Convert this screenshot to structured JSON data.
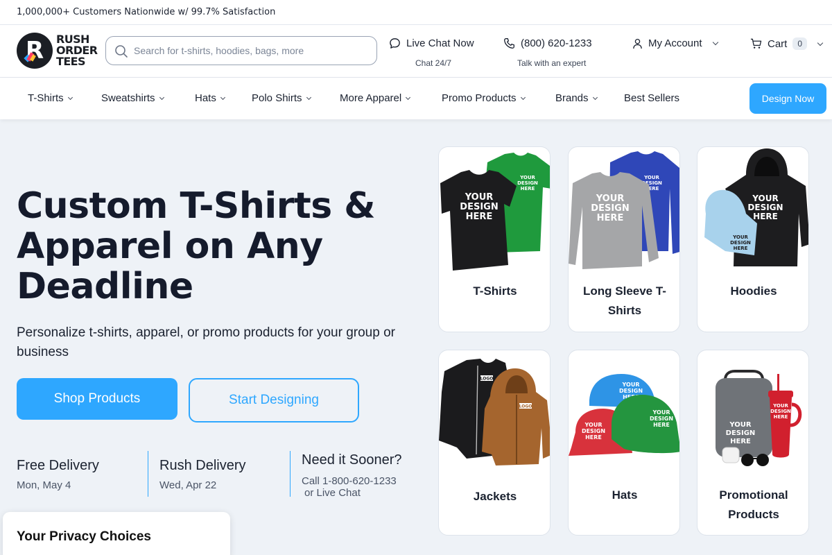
{
  "topbar": {
    "text": "1,000,000+ Customers Nationwide w/ 99.7% Satisfaction"
  },
  "logo": {
    "line1": "RUSH",
    "line2": "ORDER",
    "line3": "TEES"
  },
  "search": {
    "placeholder": "Search for t-shirts, hoodies, bags, more"
  },
  "header": {
    "chat_label": "Live Chat Now",
    "chat_sub": "Chat 24/7",
    "phone_label": "(800) 620-1233",
    "phone_sub": "Talk with an expert",
    "account_label": "My Account",
    "cart_label": "Cart",
    "cart_count": "0"
  },
  "nav": {
    "items": [
      "T-Shirts",
      "Sweatshirts",
      "Hats",
      "Polo Shirts",
      "More Apparel",
      "Promo Products",
      "Brands",
      "Best Sellers"
    ],
    "design_button": "Design Now"
  },
  "hero": {
    "title_line1": "Custom T-Shirts &",
    "title_line2": "Apparel on Any",
    "title_line3": "Deadline",
    "subtitle": "Personalize t-shirts, apparel, or promo products for your group or business",
    "primary_button": "Shop Products",
    "secondary_button": "Start Designing"
  },
  "delivery": {
    "free_title": "Free Delivery",
    "free_date": "Mon, May 4",
    "rush_title": "Rush Delivery",
    "rush_date": "Wed, Apr 22",
    "sooner_title": "Need it Sooner?",
    "sooner_line1": "Call 1-800-620-1233",
    "sooner_line2": "or Live Chat"
  },
  "categories": [
    {
      "label": "T-Shirts"
    },
    {
      "label": "Long Sleeve T-Shirts"
    },
    {
      "label": "Hoodies"
    },
    {
      "label": "Jackets"
    },
    {
      "label": "Hats"
    },
    {
      "label": "Promotional Products"
    }
  ],
  "mockup_text": {
    "l1": "YOUR",
    "l2": "DESIGN",
    "l3": "HERE",
    "logo_mark": "LOGO"
  },
  "privacy": {
    "title": "Your Privacy Choices"
  },
  "icons": {
    "search": "search-icon",
    "chat": "chat-bubble-icon",
    "phone": "phone-icon",
    "account": "user-icon",
    "cart": "cart-icon"
  },
  "colors": {
    "accent": "#2ea7ff",
    "heading": "#151b2c",
    "hero_background": "#eef2f7",
    "tshirt_green": "#1f9a3d",
    "hoodie_blue": "#a8d2ec",
    "longsleeve_blue": "#2f47b8",
    "jacket_brown": "#a5652e",
    "hat_red": "#d8323c",
    "tumbler_red": "#d1202e"
  }
}
